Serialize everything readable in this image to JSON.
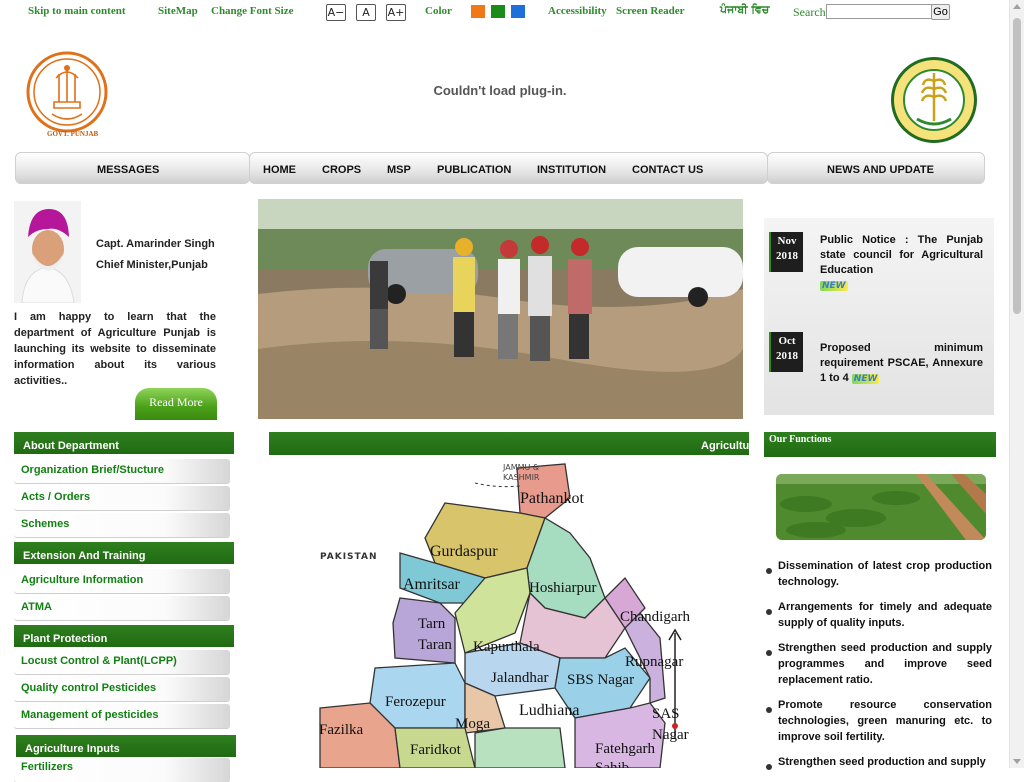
{
  "topbar": {
    "skip": "Skip to main content",
    "sitemap": "SiteMap",
    "font_size": "Change Font Size",
    "font_decrease": "A−",
    "font_normal": "A",
    "font_increase": "A+",
    "color_label": "Color",
    "colors": [
      "#f07818",
      "#1a8c1a",
      "#1e6fd9"
    ],
    "accessibility": "Accessibility",
    "screen_reader": "Screen Reader",
    "language": "ਪੰਜਾਬੀ ਵਿਚ",
    "search_label": "Search",
    "search_value": "",
    "go": "Go"
  },
  "header": {
    "plugin_message": "Couldn't load plug-in.",
    "left_logo_text": "GOVT. PUNJAB",
    "right_logo_text": "DEPARTMENT OF AGRICULTURE AND FARMERS WELFARE PUNJAB"
  },
  "nav": {
    "messages": "MESSAGES",
    "items": [
      "HOME",
      "CROPS",
      "MSP",
      "PUBLICATION",
      "INSTITUTION",
      "CONTACT US"
    ],
    "news": "NEWS AND UPDATE"
  },
  "message": {
    "name": "Capt. Amarinder Singh",
    "title": "Chief Minister,Punjab",
    "text": "I am happy to learn that the department of Agriculture Punjab is launching its website to disseminate information about its various activities..",
    "read_more": "Read More"
  },
  "sidebar": {
    "sections": [
      {
        "title": "About Department",
        "items": [
          "Organization Brief/Stucture",
          "Acts / Orders",
          "Schemes"
        ]
      },
      {
        "title": "Extension And Training",
        "items": [
          "Agriculture Information",
          "ATMA"
        ]
      },
      {
        "title": "Plant Protection",
        "items": [
          "Locust Control & Plant(LCPP)",
          "Quality control Pesticides",
          "Management of pesticides"
        ]
      },
      {
        "title": "Agriculture Inputs",
        "items": [
          "Fertilizers"
        ]
      }
    ]
  },
  "center": {
    "ticker": "Agricultu",
    "map_labels": {
      "jammu": "JAMMU &",
      "kashmir": "KASHMIR",
      "pakistan": "PAKISTAN",
      "pathankot": "Pathankot",
      "gurdaspur": "Gurdaspur",
      "amritsar": "Amritsar",
      "hoshiarpur": "Hoshiarpur",
      "chandigarh": "Chandigarh",
      "tarn": "Tarn",
      "taran": "Taran",
      "kapurthala": "Kapurthala",
      "rupnagar": "Rupnagar",
      "jalandhar": "Jalandhar",
      "sbs_nagar": "SBS Nagar",
      "ferozepur": "Ferozepur",
      "ludhiana": "Ludhiana",
      "sas": "SAS",
      "nagar": "Nagar",
      "fazilka": "Fazilka",
      "moga": "Moga",
      "faridkot": "Faridkot",
      "fatehgarh": "Fatehgarh",
      "sahib": "Sahib"
    }
  },
  "news": {
    "items": [
      {
        "month": "Nov",
        "year": "2018",
        "text": "Public Notice : The Punjab state council for Agricultural Education",
        "badge": "NEW"
      },
      {
        "month": "Oct",
        "year": "2018",
        "text": "Proposed minimum requirement PSCAE, Annexure 1 to 4",
        "badge": "NEW"
      }
    ]
  },
  "functions": {
    "title": "Our Functions",
    "items": [
      "Dissemination of latest crop production technology.",
      "Arrangements for timely and adequate supply of quality inputs.",
      "Strengthen seed production and supply programmes and improve seed replacement ratio.",
      "Promote resource conservation technologies, green manuring etc. to improve soil fertility.",
      "Strengthen seed production and supply"
    ]
  }
}
